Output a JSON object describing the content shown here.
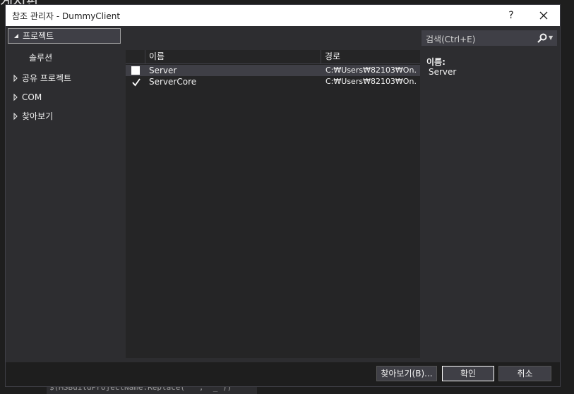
{
  "background": {
    "top_fragment": "게시판",
    "bottom_code": "$(MSBuildProjectName.Replace(\" \", \"_\"))"
  },
  "dialog": {
    "title": "참조 관리자 - DummyClient",
    "help_label": "?",
    "close_label": "✕"
  },
  "sidebar": {
    "items": [
      {
        "label": "프로젝트",
        "arrow": "◢",
        "selected": true
      },
      {
        "label": "솔루션",
        "arrow": "",
        "selected": false
      },
      {
        "label": "공유 프로젝트",
        "arrow": "▷",
        "selected": false
      },
      {
        "label": "COM",
        "arrow": "▷",
        "selected": false
      },
      {
        "label": "찾아보기",
        "arrow": "▷",
        "selected": false
      }
    ]
  },
  "search": {
    "placeholder": "검색(Ctrl+E)",
    "icon": "search-icon"
  },
  "list": {
    "columns": {
      "name": "이름",
      "path": "경로"
    },
    "rows": [
      {
        "name": "Server",
        "path": "C:₩Users₩82103₩On...",
        "checked": false,
        "highlight": true
      },
      {
        "name": "ServerCore",
        "path": "C:₩Users₩82103₩On...",
        "checked": true,
        "highlight": false
      }
    ]
  },
  "info": {
    "label": "이름:",
    "value": "Server"
  },
  "footer": {
    "browse_label": "찾아보기(B)...",
    "ok_label": "확인",
    "cancel_label": "취소"
  },
  "colors": {
    "dialog_bg": "#2d2d30",
    "list_bg": "#252526",
    "titlebar_bg": "#ffffff",
    "text": "#f1f1f1"
  }
}
